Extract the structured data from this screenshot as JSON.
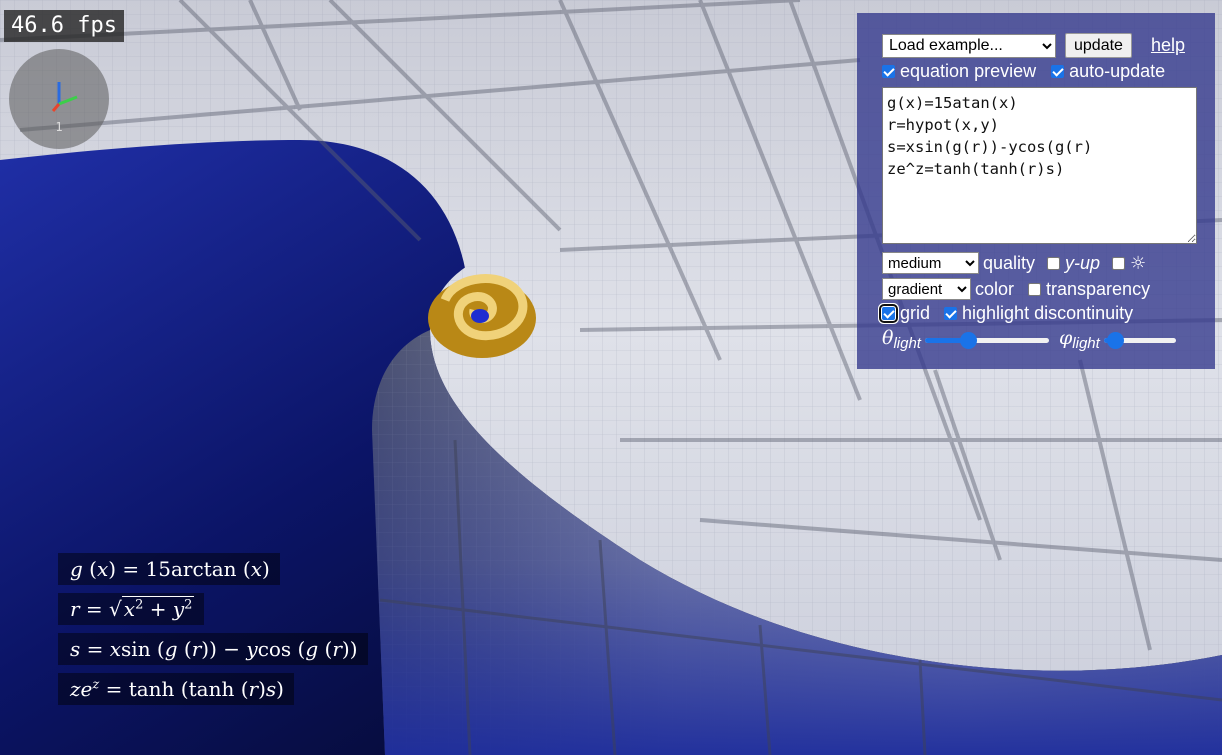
{
  "fps_label": "46.6 fps",
  "axes_widget": {
    "label": "1"
  },
  "panel": {
    "example_select": {
      "value": "Load example..."
    },
    "update_label": "update",
    "help_label": "help",
    "equation_preview": {
      "label": "equation preview",
      "checked": true
    },
    "auto_update": {
      "label": "auto-update",
      "checked": true
    },
    "equations_text": "g(x)=15atan(x)\nr=hypot(x,y)\ns=xsin(g(r))-ycos(g(r)\nze^z=tanh(tanh(r)s)",
    "quality": {
      "value": "medium",
      "label": "quality"
    },
    "y_up": {
      "label": "y-up",
      "checked": false
    },
    "sun_toggle": {
      "label": "☼",
      "checked": false
    },
    "color_mode": {
      "value": "gradient",
      "label": "color"
    },
    "transparency": {
      "label": "transparency",
      "checked": false
    },
    "grid": {
      "label": "grid",
      "checked": true
    },
    "highlight_discontinuity": {
      "label": "highlight discontinuity",
      "checked": true
    },
    "theta_light": {
      "symbol": "θ",
      "sub": "light",
      "value": 0.35
    },
    "phi_light": {
      "symbol": "φ",
      "sub": "light",
      "value": 0.15
    }
  },
  "preview": {
    "eq1": {
      "lhs": "g",
      "arg": "x",
      "rhs_coef": "15arctan",
      "rhs_arg": "x"
    },
    "eq2": {
      "lhs": "r",
      "radicand_a": "x",
      "radicand_b": "y",
      "exp": "2"
    },
    "eq3": {
      "lhs": "s",
      "t1": "x",
      "f1": "sin",
      "t2": "y",
      "f2": "cos",
      "g": "g",
      "r": "r"
    },
    "eq4": {
      "lhs": "ze",
      "exp": "z",
      "f": "tanh",
      "r": "r",
      "s": "s"
    }
  },
  "colors": {
    "panel_bg": "#323789",
    "accent": "#1a73e8",
    "surface_blue": "#1d2fa8",
    "surface_white": "#e8eaf0",
    "spiral_gold": "#d7a21c"
  }
}
